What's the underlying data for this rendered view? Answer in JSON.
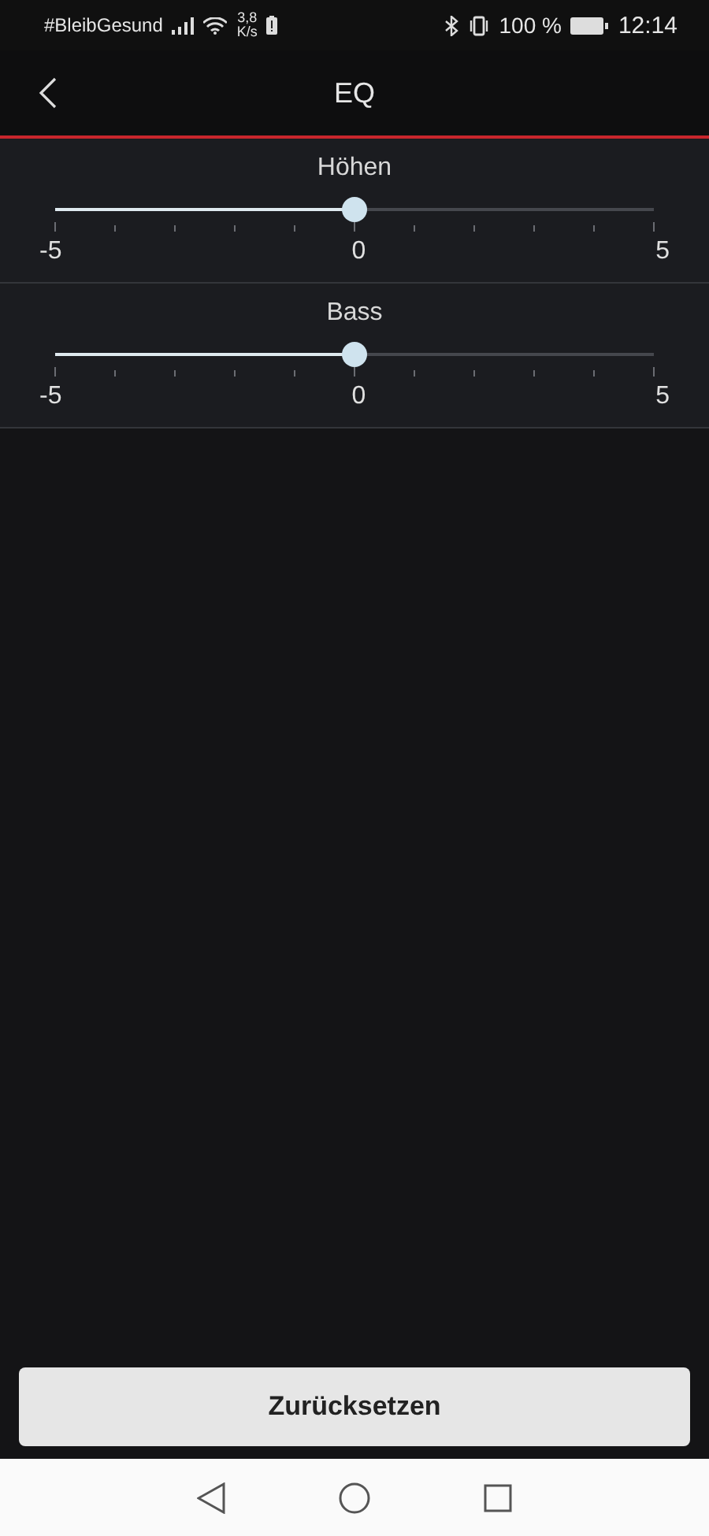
{
  "status_bar": {
    "hashtag": "#BleibGesund",
    "speed_value": "3,8",
    "speed_unit": "K/s",
    "battery_percent": "100 %",
    "time": "12:14"
  },
  "header": {
    "title": "EQ"
  },
  "sliders": [
    {
      "label": "Höhen",
      "level": 0.5,
      "min_label": "-5",
      "mid_label": "0",
      "max_label": "5"
    },
    {
      "label": "Bass",
      "level": 0.5,
      "min_label": "-5",
      "mid_label": "0",
      "max_label": "5"
    }
  ],
  "reset_button": "Zurücksetzen"
}
